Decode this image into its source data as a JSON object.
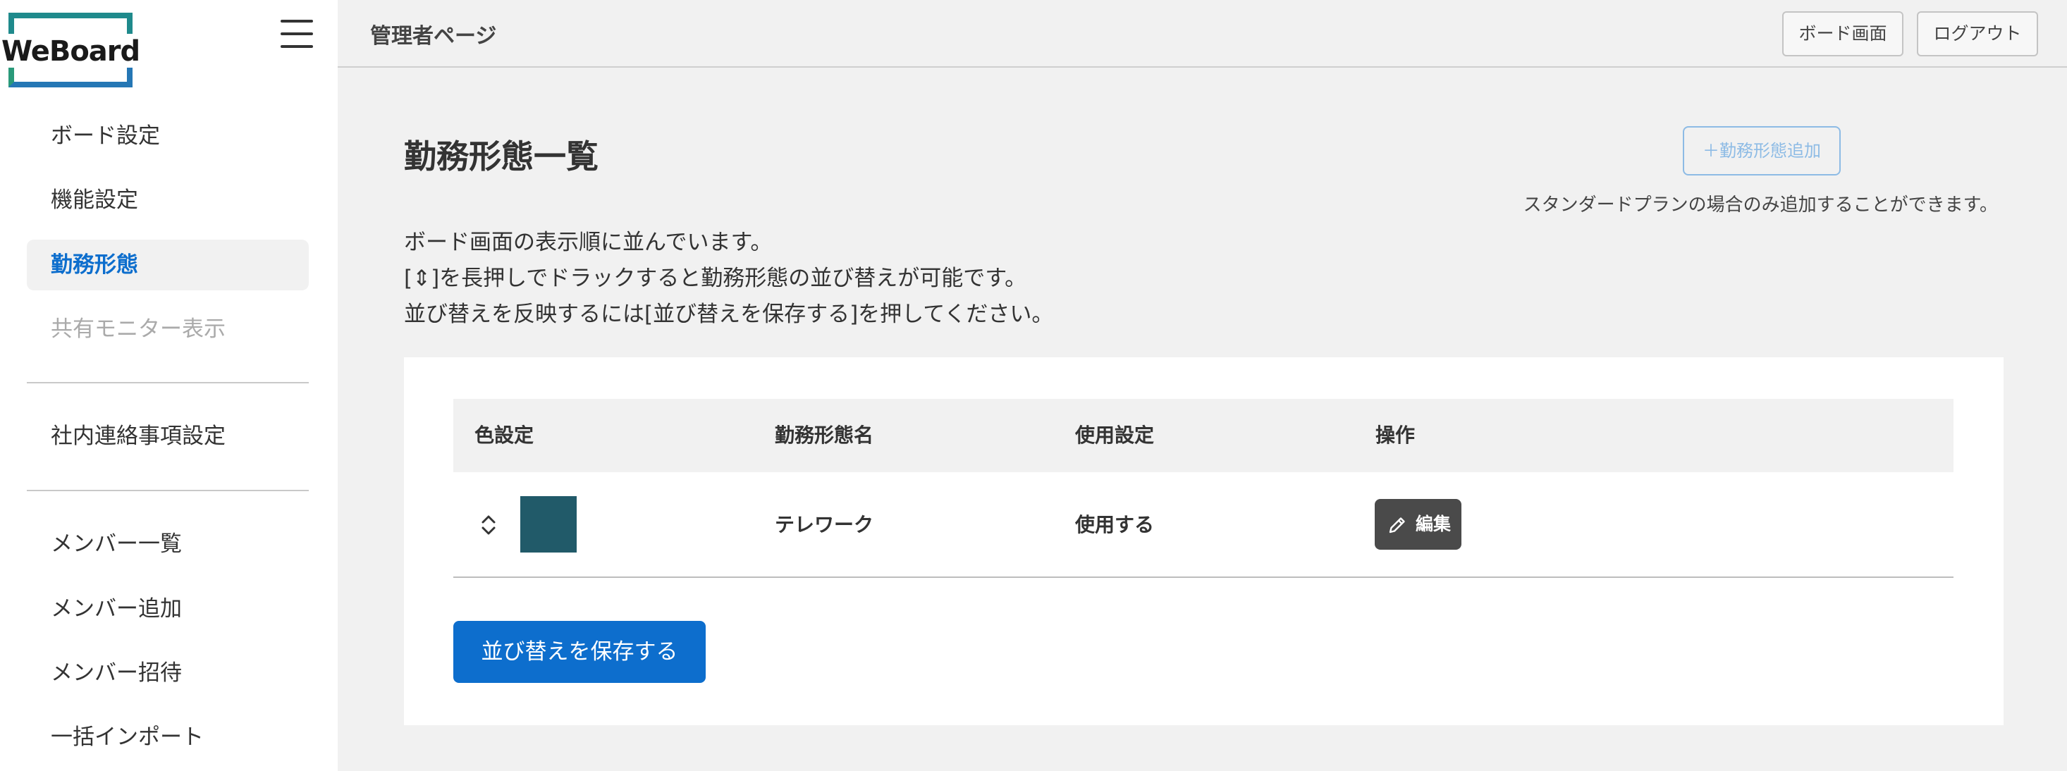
{
  "app": {
    "logo_text": "WeBoard",
    "brand_colors": {
      "teal": "#1f8a8c",
      "green": "#2a9a7a",
      "blue": "#2577b5"
    }
  },
  "header": {
    "title": "管理者ページ",
    "board_button": "ボード画面",
    "logout_button": "ログアウト"
  },
  "sidebar": {
    "items": [
      {
        "label": "ボード設定",
        "state": "normal"
      },
      {
        "label": "機能設定",
        "state": "normal"
      },
      {
        "label": "勤務形態",
        "state": "active"
      },
      {
        "label": "共有モニター表示",
        "state": "disabled"
      },
      {
        "label": "社内連絡事項設定",
        "state": "normal"
      },
      {
        "label": "メンバー一覧",
        "state": "normal"
      },
      {
        "label": "メンバー追加",
        "state": "normal"
      },
      {
        "label": "メンバー招待",
        "state": "normal"
      },
      {
        "label": "一括インポート",
        "state": "normal"
      }
    ]
  },
  "main": {
    "title": "勤務形態一覧",
    "add_button": "＋勤務形態追加",
    "add_note": "スタンダードプランの場合のみ追加することができます。",
    "description": [
      "ボード画面の表示順に並んでいます。",
      "[⇕]を長押しでドラックすると勤務形態の並び替えが可能です。",
      "並び替えを反映するには[並び替えを保存する]を押してください。"
    ],
    "table": {
      "headers": [
        "色設定",
        "勤務形態名",
        "使用設定",
        "操作"
      ],
      "rows": [
        {
          "color": "#215a69",
          "name": "テレワーク",
          "usage": "使用する",
          "action": "編集"
        }
      ]
    },
    "save_button": "並び替えを保存する",
    "accent_color": "#0d6ecd"
  }
}
